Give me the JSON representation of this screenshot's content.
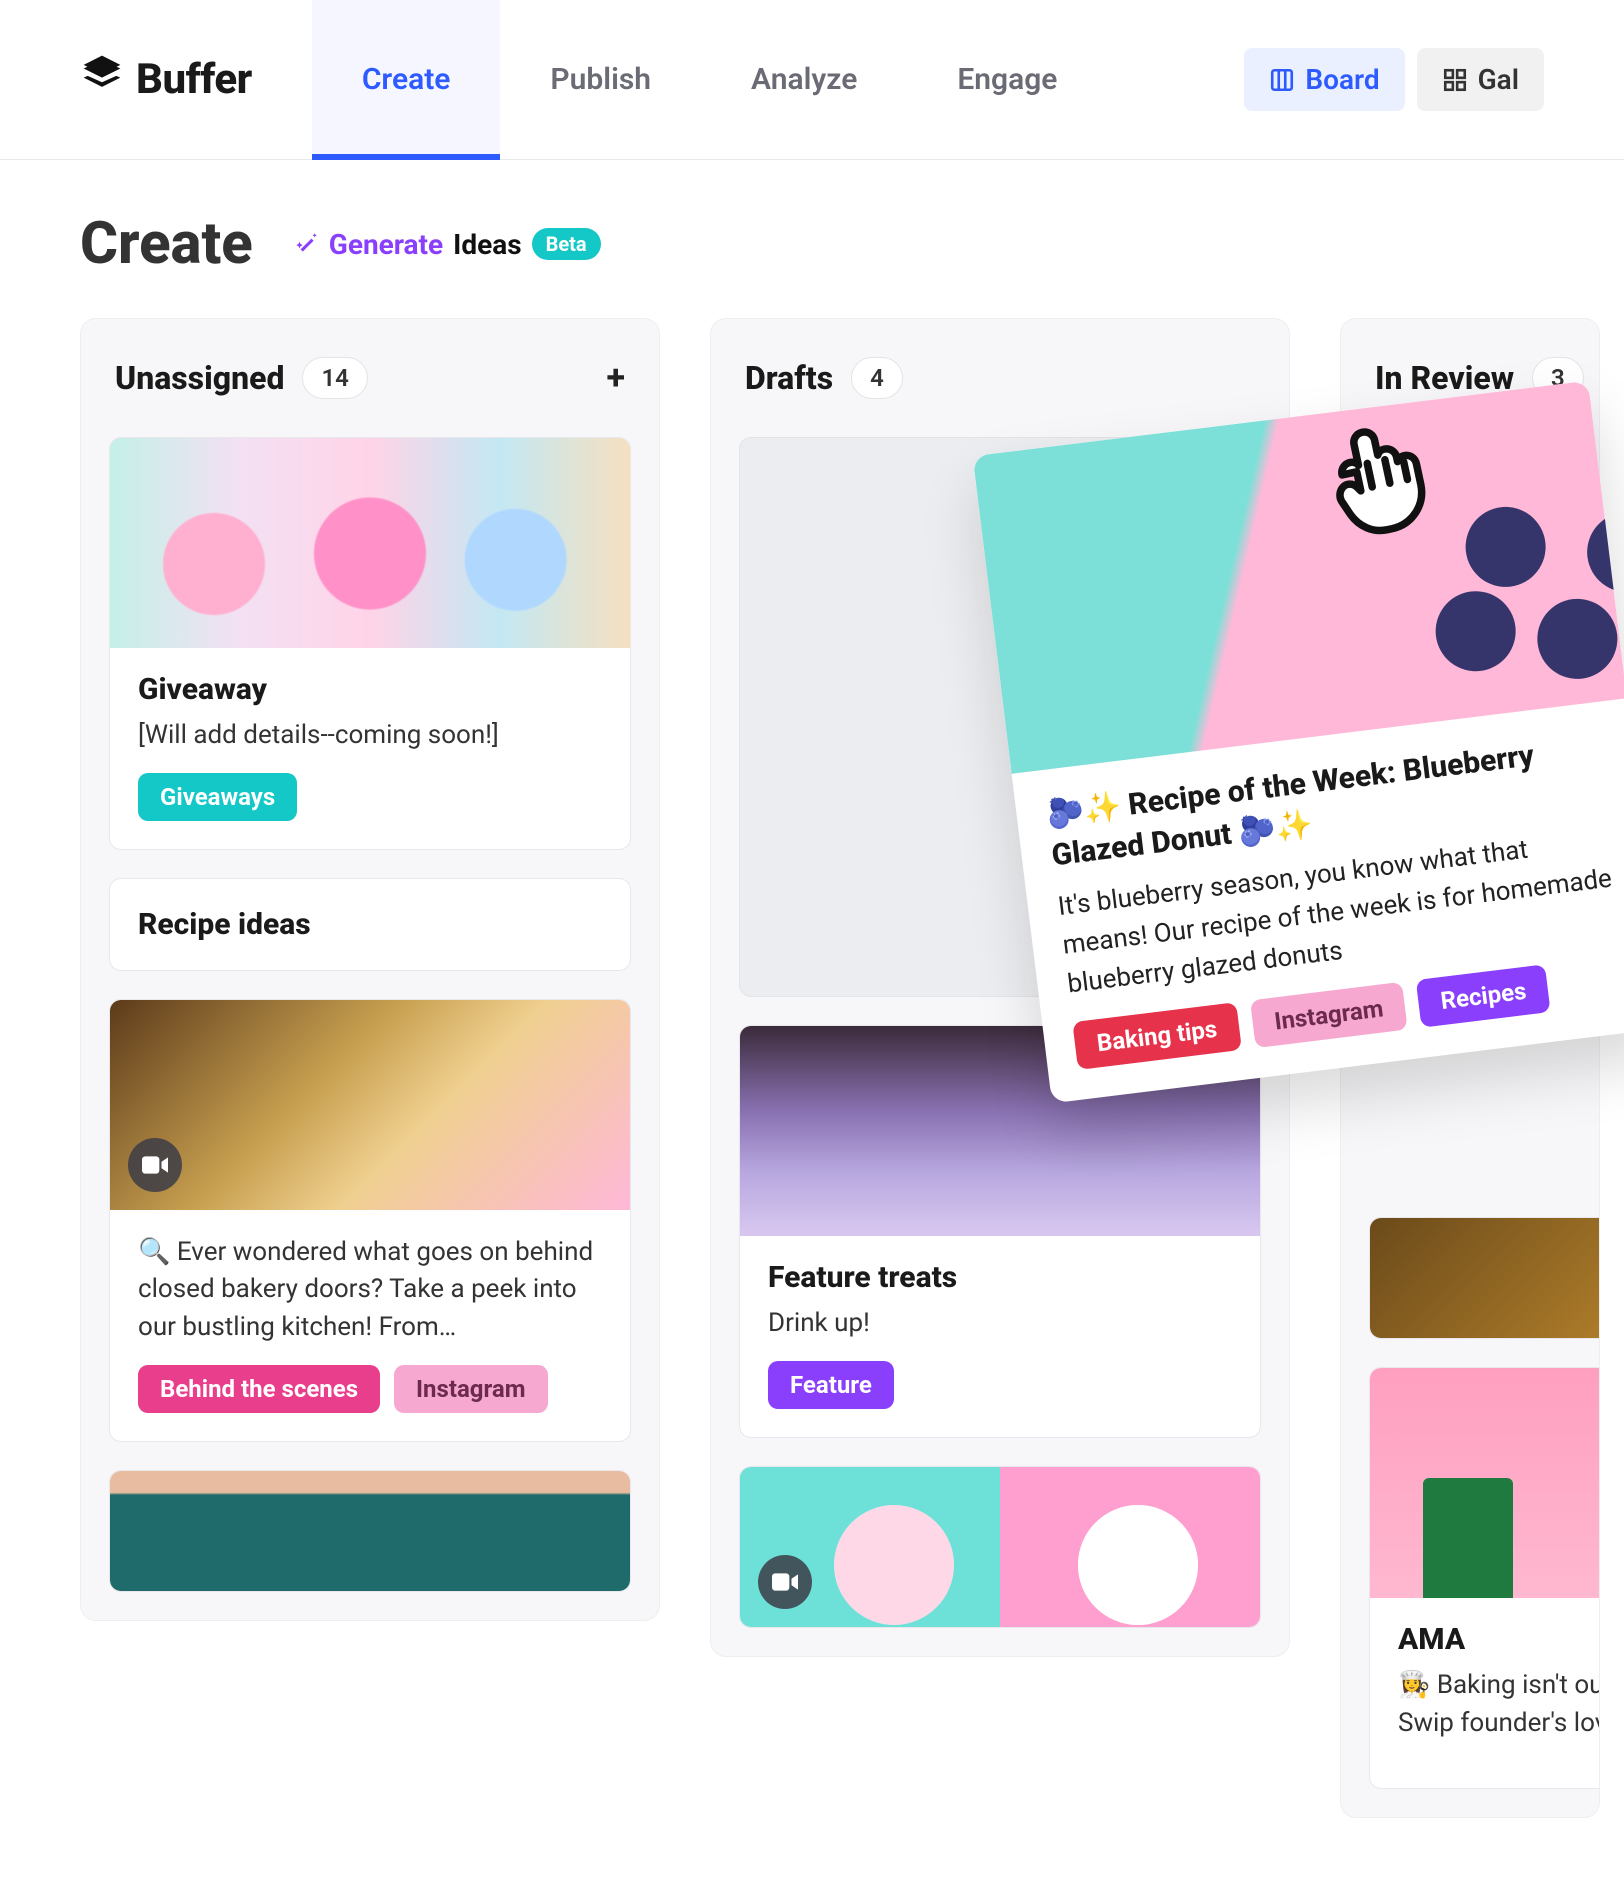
{
  "brand": "Buffer",
  "nav": {
    "tabs": [
      "Create",
      "Publish",
      "Analyze",
      "Engage"
    ],
    "active": 0
  },
  "view_toggle": {
    "board": "Board",
    "gallery": "Gal"
  },
  "page": {
    "title": "Create",
    "generate_label_1": "Generate",
    "generate_label_2": "Ideas",
    "beta": "Beta"
  },
  "columns": {
    "unassigned": {
      "title": "Unassigned",
      "count": "14"
    },
    "drafts": {
      "title": "Drafts",
      "count": "4"
    },
    "inreview": {
      "title": "In Review",
      "count": "3"
    }
  },
  "cards": {
    "giveaway": {
      "title": "Giveaway",
      "text": "[Will add details--coming soon!]",
      "tag1": "Giveaways"
    },
    "recipe_ideas": {
      "title": "Recipe ideas"
    },
    "behind": {
      "text": "🔍 Ever wondered what goes on behind closed bakery doors? Take a peek into our bustling kitchen! From…",
      "tag1": "Behind the scenes",
      "tag2": "Instagram"
    },
    "feature_treats": {
      "title": "Feature treats",
      "text": "Drink up!",
      "tag1": "Feature"
    },
    "ama": {
      "title": "AMA",
      "text": "👩‍🍳 Baking isn't our story. Swip founder's love"
    }
  },
  "floating": {
    "title": "🫐✨ Recipe of the Week: Blueberry Glazed Donut 🫐✨",
    "text": "It's blueberry season, you know what that means! Our recipe of the week is for homemade blueberry glazed donuts",
    "tag1": "Baking tips",
    "tag2": "Instagram",
    "tag3": "Recipes"
  }
}
